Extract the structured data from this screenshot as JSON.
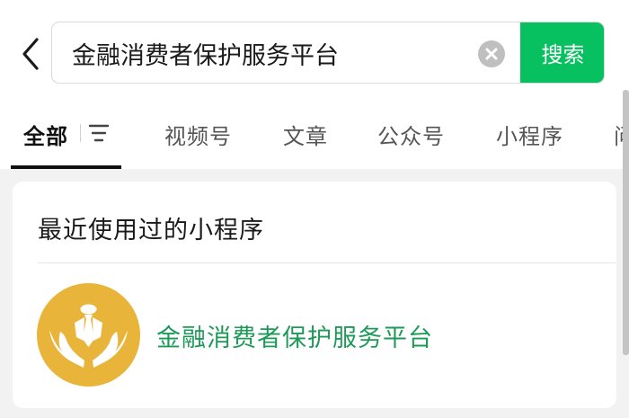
{
  "header": {
    "back_icon": "chevron-left-icon",
    "search": {
      "value": "金融消费者保护服务平台",
      "clear_icon": "clear-circle-icon",
      "button_label": "搜索",
      "button_color": "#07c160"
    }
  },
  "tabs": {
    "items": [
      {
        "label": "全部",
        "active": true
      },
      {
        "label": "视频号"
      },
      {
        "label": "文章"
      },
      {
        "label": "公众号"
      },
      {
        "label": "小程序"
      },
      {
        "label": "问"
      }
    ],
    "filter_icon": "filter-icon"
  },
  "recent_section": {
    "title": "最近使用过的小程序",
    "apps": [
      {
        "name": "金融消费者保护服务平台",
        "logo_icon": "hands-protecting-person-icon",
        "logo_color": "#e8b53a",
        "name_color": "#1d9a58"
      }
    ]
  }
}
